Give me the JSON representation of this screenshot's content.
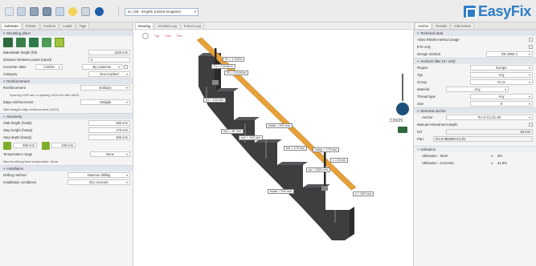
{
  "toolbar": {
    "language": "en_GB - English (United Kingdom)",
    "brand": "EasyFix"
  },
  "left": {
    "tabs": [
      "Substrate",
      "Fixture",
      "Anchors",
      "Loads",
      "Tags"
    ],
    "mounting": {
      "section": "Mounting place",
      "balustrade_label": "Balustrade height (hb)",
      "balustrade_value": "1100 mm",
      "posts_label": "Distance between posts (npost)",
      "posts_value": "2",
      "concrete_label": "Concrete class",
      "concrete_value": "C20/25",
      "concrete_by": "By customer",
      "category_label": "Category",
      "category_value": "Non-cracked"
    },
    "reinforcement": {
      "section": "Reinforcement",
      "label": "Reinforcement",
      "value": "Ordinary",
      "note1": "Spacing ≥150 mm or spacing ≥100 mm with ≤8/10",
      "edge_label": "Edge reinforcement",
      "edge_value": "Straight",
      "note2": "With straight edge reinforcement (≥Ø12)"
    },
    "geometry": {
      "section": "Geometry",
      "slab_label": "Slab height (hslab)",
      "slab_value": "200 mm",
      "step_h_label": "Step height (hstep)",
      "step_h_value": "170 mm",
      "step_d_label": "Step depth (bstep)",
      "step_d_value": "300 mm",
      "dim1": "500 mm",
      "dim2": "100 mm"
    },
    "temperature": {
      "label": "Temperature range",
      "value": "None",
      "note": "Max short/long term temperature: None"
    },
    "installation": {
      "section": "Installation",
      "drill_label": "Drilling method",
      "drill_value": "Hammer drilling",
      "cond_label": "Installation conditions",
      "cond_value": "Dry concrete"
    }
  },
  "center": {
    "tabs": [
      "Drawing",
      "Anchors Log",
      "Forces Log"
    ],
    "view_icons": [
      "Top",
      "Fvw",
      "Fsd"
    ],
    "labels": {
      "l1": "Fh = 1 kN/m",
      "l2": "Fv = 0.8 kN/m",
      "l3": "Fh = 0.8 kN/m",
      "d1": "a1 = 100 mm",
      "d2": "hs1 = 80 mm",
      "d3": "hs2 = 100 mm",
      "d4": "hslab = 200 mm",
      "d5": "hef = 170 mm",
      "d6": "hstep = 170 mm",
      "d7": "bs = 1100 mm",
      "d8": "c = 8 mm",
      "d9": "hslab = 200 mm",
      "d10": "c = 100 mm"
    },
    "concrete_tag": "C20/25"
  },
  "right": {
    "tabs": [
      "Anchor",
      "Results",
      "Information"
    ],
    "technical": {
      "section": "Technical data",
      "text1": "Allow REDM method usage",
      "text2": "ETA only",
      "design_label": "Design method",
      "design_value": "EN 1992-4"
    },
    "filter": {
      "section": "Anchors filter (8 / 443)",
      "region_label": "Region",
      "region_value": "Europe",
      "typ_label": "Typ",
      "typ_value": "Any",
      "group_label": "Group",
      "group_value": "R-LX",
      "material_label": "Material",
      "material_value": "Any",
      "thread_label": "Thread type",
      "thread_value": "Any",
      "size_label": "Size",
      "size_value": "8"
    },
    "selected": {
      "section": "Selected anchor",
      "anchor_label": "Anchor",
      "anchor_value": "R-LX-C1-Z1-35",
      "manual_label": "Manual embedment depth",
      "hef_label": "hef",
      "hef_value": "53 mm",
      "part_label": "Part",
      "part_value": "R-LX-08S060-C1-Z1"
    },
    "utilisation": {
      "section": "Utilisation",
      "steel_label": "Utilisation - Steel",
      "steel_value": "9%",
      "concrete_label": "Utilisation - Concrete",
      "concrete_value": "41.8%"
    }
  }
}
